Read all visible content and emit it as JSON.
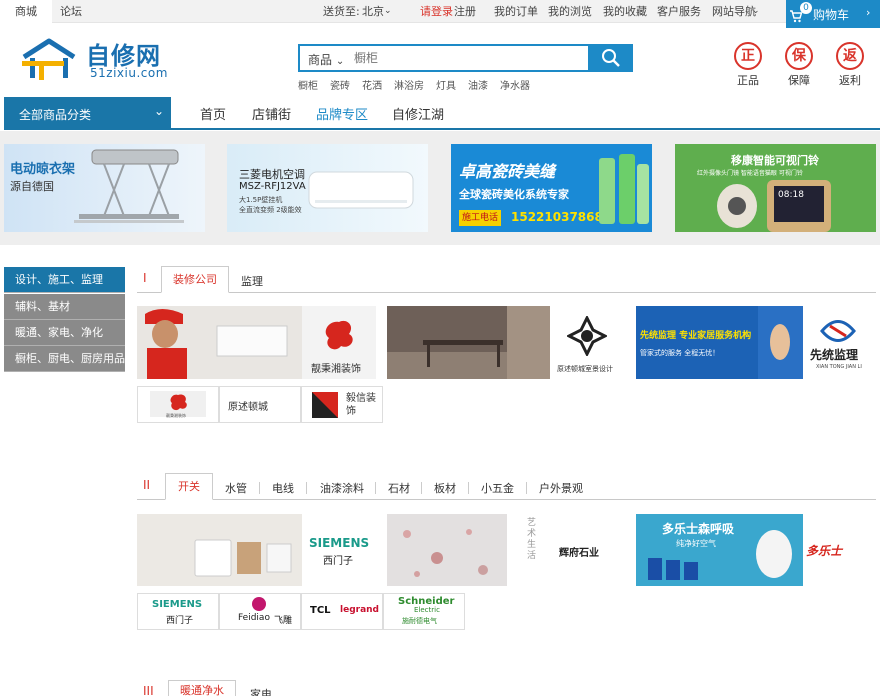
{
  "topbar": {
    "tab_mall": "商城",
    "tab_forum": "论坛",
    "ship_to_label": "送货至:",
    "ship_to_city": "北京",
    "login": "请登录",
    "register": "注册",
    "links": [
      "我的订单",
      "我的浏览",
      "我的收藏",
      "客户服务",
      "网站导航"
    ],
    "cart_label": "购物车",
    "cart_count": "0"
  },
  "header": {
    "logo_name": "自修网",
    "logo_domain": "51zixiu.com",
    "search_category": "商品",
    "search_placeholder": "橱柜",
    "hot_keywords": [
      "橱柜",
      "瓷砖",
      "花洒",
      "淋浴房",
      "灯具",
      "油漆",
      "净水器"
    ],
    "badges": [
      {
        "icon": "正",
        "label": "正品"
      },
      {
        "icon": "保",
        "label": "保障"
      },
      {
        "icon": "返",
        "label": "返利"
      }
    ]
  },
  "nav": {
    "all_categories": "全部商品分类",
    "items": [
      "首页",
      "店铺街",
      "品牌专区",
      "自修江湖"
    ],
    "active_index": 2,
    "accent": "#1a76a8",
    "active_color": "#1d8ac7"
  },
  "banners": [
    {
      "title": "电动晾衣架",
      "subtitle": "源自德国"
    },
    {
      "title": "三菱电机空调",
      "model": "MSZ-RFJ12VA",
      "line1": "大1.5P壁挂机",
      "line2": "全直流变频 2级能效"
    },
    {
      "title": "卓高瓷砖美缝",
      "subtitle": "全球瓷砖美化系统专家",
      "phone_label": "施工电话",
      "phone": "15221037868"
    },
    {
      "title": "移康智能可视门铃",
      "subtitle": "红外摄像头门镜 智能语音猫眼 可视门铃",
      "screen_time": "08:18"
    }
  ],
  "sidebar": {
    "items": [
      "设计、施工、监理",
      "辅料、基材",
      "暖通、家电、净化",
      "橱柜、厨电、厨房用品"
    ],
    "active_index": 0
  },
  "section1": {
    "num": "I",
    "tabs": [
      "装修公司",
      "监理"
    ],
    "tiles": [
      {
        "brand": "靓秉湘装饰"
      },
      {
        "brand": "原述顿城室景设计"
      },
      {
        "headline": "先统监理 专业家居服务机构",
        "sub": "管家式的服务 全程无忧！",
        "brand": "先统监理",
        "brand_en": "XIAN TONG JIAN LI"
      }
    ],
    "logos": [
      "靓秉湘装饰",
      "原述顿城",
      "毅信装饰"
    ]
  },
  "section2": {
    "num": "II",
    "tabs": [
      "开关",
      "水管",
      "电线",
      "油漆涂料",
      "石材",
      "板材",
      "小五金",
      "户外景观"
    ],
    "tiles": [
      {
        "brand": "SIEMENS",
        "brand_cn": "西门子"
      },
      {
        "brand": "辉府石业",
        "vertical": "艺术生活"
      },
      {
        "headline": "多乐士森呼吸",
        "sub": "纯净好空气",
        "brand": "多乐士"
      }
    ],
    "logos": [
      {
        "name": "SIEMENS",
        "cn": "西门子"
      },
      {
        "name": "Feidiao",
        "cn": "飞雕"
      },
      {
        "name": "TCL",
        "cn": "legrand"
      },
      {
        "name": "Schneider",
        "sub": "Electric",
        "cn": "施耐德电气"
      }
    ]
  },
  "section3": {
    "num": "III",
    "tabs": [
      "暖通净水",
      "家电"
    ]
  }
}
